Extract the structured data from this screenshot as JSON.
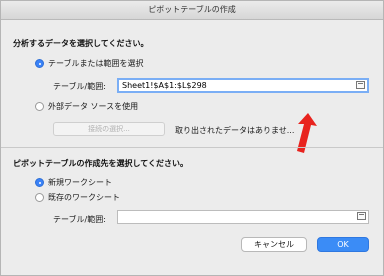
{
  "window": {
    "title": "ピボットテーブルの作成"
  },
  "source_section": {
    "heading": "分析するデータを選択してください。",
    "option_table": "テーブルまたは範囲を選択",
    "table_range_label": "テーブル/範囲:",
    "table_range_value": "Sheet1!$A$1:$L$298",
    "option_external": "外部データ ソースを使用",
    "choose_connection_button": "接続の選択...",
    "no_data_text": "取り出されたデータはありませ..."
  },
  "destination_section": {
    "heading": "ピボットテーブルの作成先を選択してください。",
    "option_new_sheet": "新規ワークシート",
    "option_existing_sheet": "既存のワークシート",
    "table_range_label": "テーブル/範囲:",
    "table_range_value": ""
  },
  "buttons": {
    "cancel": "キャンセル",
    "ok": "OK"
  },
  "colors": {
    "accent": "#3b8cf6",
    "annotation_arrow": "#e8231e"
  }
}
